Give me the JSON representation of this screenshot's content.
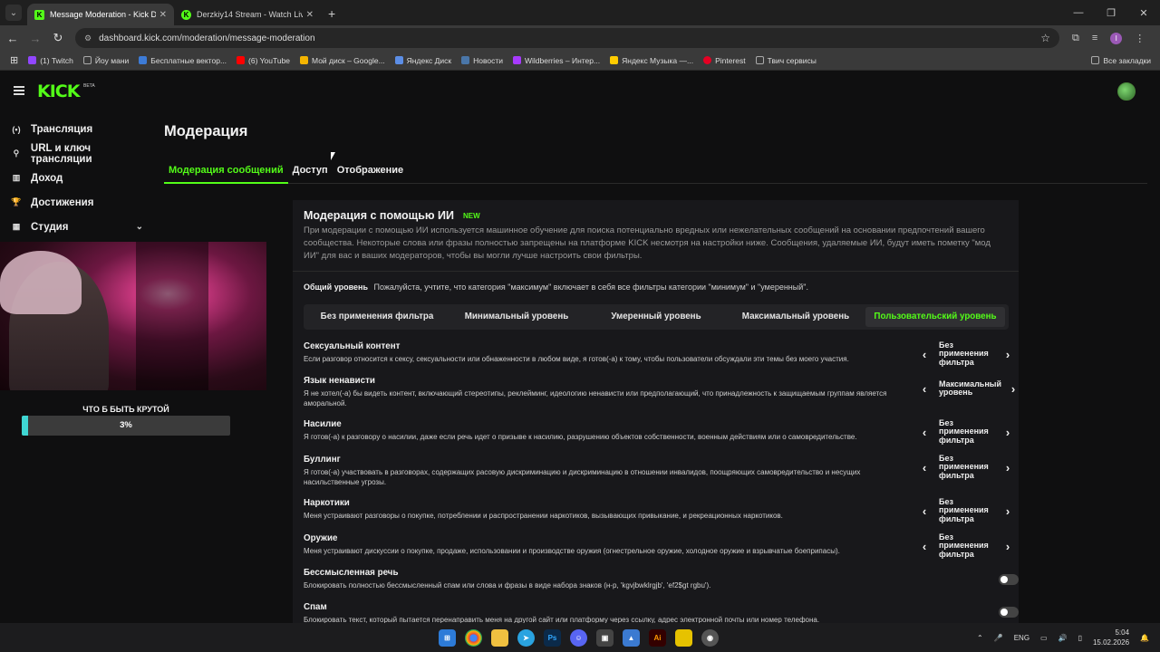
{
  "browser": {
    "tabs": [
      {
        "title": "Message Moderation - Kick Da",
        "icon_color": "#53fc18",
        "icon": "K",
        "active": true
      },
      {
        "title": "Derzkiy14 Stream - Watch Live",
        "icon_color": "#53fc18",
        "icon": "K",
        "active": false
      }
    ],
    "url": "dashboard.kick.com/moderation/message-moderation",
    "profile_initial": "I",
    "bookmarks": [
      {
        "label": "(1) Twitch",
        "color": "#9146ff"
      },
      {
        "label": "Йоу мани",
        "color": "#888888"
      },
      {
        "label": "Бесплатные вектор...",
        "color": "#3d7bd6"
      },
      {
        "label": "(6) YouTube",
        "color": "#ff0000"
      },
      {
        "label": "Мой диск – Google...",
        "color": "#f4b400"
      },
      {
        "label": "Яндекс Диск",
        "color": "#5c8ee6"
      },
      {
        "label": "Новости",
        "color": "#4a76a8"
      },
      {
        "label": "Wildberries – Интер...",
        "color": "#a73afd"
      },
      {
        "label": "Яндекс Музыка —...",
        "color": "#ffcc00"
      },
      {
        "label": "Pinterest",
        "color": "#e60023"
      },
      {
        "label": "Твич сервисы",
        "color": "#888888"
      }
    ],
    "all_bookmarks": "Все закладки"
  },
  "kick": {
    "logo": "KICK",
    "beta": "BETA"
  },
  "sidebar": {
    "items": [
      {
        "label": "Трансляция",
        "icon": "broadcast-icon",
        "glyph": "(•)"
      },
      {
        "label": "URL и ключ трансляции",
        "icon": "link-icon",
        "glyph": "⚲"
      },
      {
        "label": "Доход",
        "icon": "chart-icon",
        "glyph": "▥"
      },
      {
        "label": "Достижения",
        "icon": "trophy-icon",
        "glyph": "🏆"
      },
      {
        "label": "Студия",
        "icon": "studio-icon",
        "glyph": "▦"
      }
    ]
  },
  "overlay": {
    "goal_title": "ЧТО Б БЫТЬ КРУТОЙ",
    "goal_text": "3%",
    "goal_progress": 0.03
  },
  "page": {
    "title": "Модерация",
    "tabs": [
      "Модерация сообщений",
      "Доступ",
      "Отображение"
    ]
  },
  "ai": {
    "title": "Модерация с помощью ИИ",
    "badge": "NEW",
    "description": "При модерации с помощью ИИ используется машинное обучение для поиска потенциально вредных или нежелательных сообщений на основании предпочтений вашего сообщества. Некоторые слова или фразы полностью запрещены на платформе KICK несмотря на настройки ниже. Сообщения, удаляемые ИИ, будут иметь пометку \"мод ИИ\" для вас и ваших модераторов, чтобы вы могли лучше настроить свои фильтры."
  },
  "level": {
    "label": "Общий уровень",
    "note": "Пожалуйста, учтите, что категория \"максимум\" включает в себя все фильтры категории \"минимум\" и \"умеренный\".",
    "options": [
      "Без применения фильтра",
      "Минимальный уровень",
      "Умеренный уровень",
      "Максимальный уровень",
      "Пользовательский уровень"
    ],
    "selected": "Пользовательский уровень"
  },
  "rules": [
    {
      "title": "Сексуальный контент",
      "desc": "Если разговор относится к сексу, сексуальности или обнаженности в любом виде, я готов(-а) к тому, чтобы пользователи обсуждали эти темы без моего участия.",
      "value": "Без применения фильтра"
    },
    {
      "title": "Язык ненависти",
      "desc": "Я не хотел(-а) бы видеть контент, включающий стереотипы, реклейминг, идеологию ненависти или предполагающий, что принадлежность к защищаемым группам является аморальной.",
      "value": "Максимальный уровень"
    },
    {
      "title": "Насилие",
      "desc": "Я готов(-а) к разговору о насилии, даже если речь идет о призыве к насилию, разрушению объектов собственности, военным действиям или о самовредительстве.",
      "value": "Без применения фильтра"
    },
    {
      "title": "Буллинг",
      "desc": "Я готов(-а) участвовать в разговорах, содержащих расовую дискриминацию и дискриминацию в отношении инвалидов, поощряющих самовредительство и несущих насильственные угрозы.",
      "value": "Без применения фильтра"
    },
    {
      "title": "Наркотики",
      "desc": "Меня устраивают разговоры о покупке, потреблении и распространении наркотиков, вызывающих привыкание, и рекреационных наркотиков.",
      "value": "Без применения фильтра"
    },
    {
      "title": "Оружие",
      "desc": "Меня устраивают дискуссии о покупке, продаже, использовании и производстве оружия (огнестрельное оружие, холодное оружие и взрывчатые боеприпасы).",
      "value": "Без применения фильтра"
    }
  ],
  "toggles": [
    {
      "title": "Бессмысленная речь",
      "desc": "Блокировать полностью бессмысленный спам или слова и фразы в виде набора знаков (н-р, 'kgvjbwklrgjb', 'ef2$gt rgbu').",
      "on": false
    },
    {
      "title": "Спам",
      "desc": "Блокировать текст, который пытается перенаправить меня на другой сайт или платформу через ссылку, адрес электронной почты или номер телефона.",
      "on": false
    }
  ],
  "taskbar": {
    "lang": "ENG",
    "time": "5:04",
    "date": "15.02.2026"
  },
  "colors": {
    "accent": "#53fc18",
    "goal_fill": "#3fd6d3"
  }
}
